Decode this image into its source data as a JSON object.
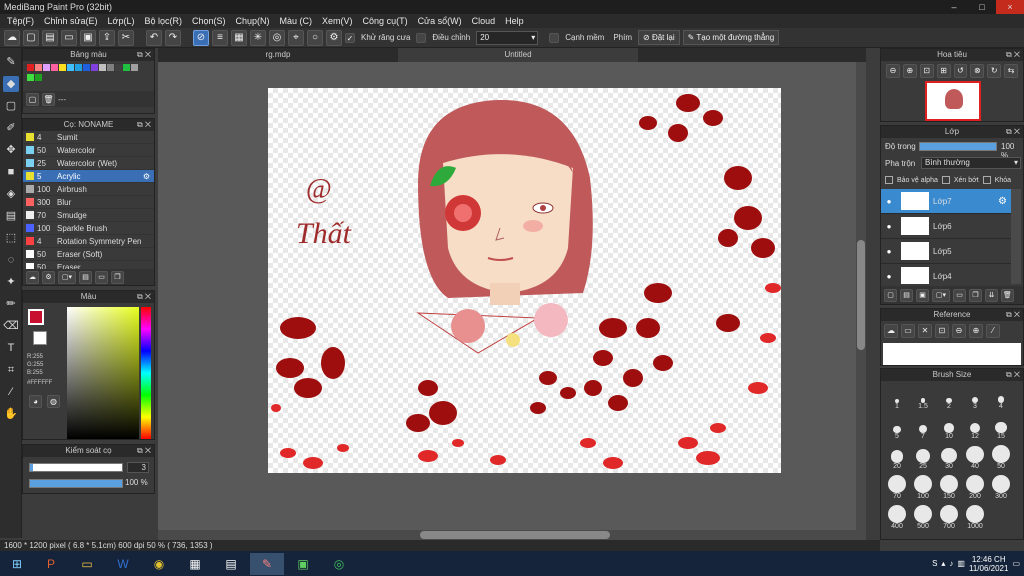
{
  "window": {
    "title": "MediBang Paint Pro (32bit)"
  },
  "menu": [
    "Tệp(F)",
    "Chỉnh sửa(E)",
    "Lớp(L)",
    "Bộ lọc(R)",
    "Chọn(S)",
    "Chụp(N)",
    "Màu (C)",
    "Xem(V)",
    "Công cụ(T)",
    "Cửa sổ(W)",
    "Cloud",
    "Help"
  ],
  "toolbar": {
    "antialias": "Khử răng cưa",
    "correction_label": "Điều chỉnh",
    "correction_value": "20",
    "soft_edge": "Cạnh mềm",
    "key_label": "Phím",
    "reset": "Đặt lại",
    "make_perspective": "Tạo một đường thẳng"
  },
  "palette": {
    "title": "Bảng màu",
    "empty": "---"
  },
  "brushes": {
    "title": "Cọ: NONAME",
    "items": [
      {
        "size": "4",
        "name": "Sumit",
        "color": "#e8e030"
      },
      {
        "size": "50",
        "name": "Watercolor",
        "color": "#7ad0f0"
      },
      {
        "size": "25",
        "name": "Watercolor (Wet)",
        "color": "#7ad0f0"
      },
      {
        "size": "5",
        "name": "Acrylic",
        "color": "#e8e030"
      },
      {
        "size": "100",
        "name": "Airbrush",
        "color": "#aaaaaa"
      },
      {
        "size": "300",
        "name": "Blur",
        "color": "#ff6060"
      },
      {
        "size": "70",
        "name": "Smudge",
        "color": "#eeeeee"
      },
      {
        "size": "100",
        "name": "Sparkle Brush",
        "color": "#4a60ff"
      },
      {
        "size": "4",
        "name": "Rotation Symmetry Pen",
        "color": "#ff4040"
      },
      {
        "size": "50",
        "name": "Eraser (Soft)",
        "color": "#ffffff"
      },
      {
        "size": "50",
        "name": "Eraser",
        "color": "#ffffff"
      }
    ]
  },
  "color": {
    "title": "Màu",
    "r": "R:255",
    "g": "G:255",
    "b": "B:255",
    "hex": "#FFFFFF"
  },
  "brush_control": {
    "title": "Kiểm soát cọ",
    "size": "3",
    "opacity": "100 %"
  },
  "tabs": [
    "rg.mdp",
    "Untitled"
  ],
  "canvas": {
    "signature_at": "@",
    "signature_name": "Thất"
  },
  "status": {
    "text": "1600 * 1200 pixel  ( 6.8 * 5.1cm)  600 dpi  50 %  ( 736, 1353 )"
  },
  "navigator": {
    "title": "Hoa tiêu"
  },
  "layers": {
    "title": "Lớp",
    "opacity_label": "Độ trong",
    "opacity_value": "100 %",
    "blend_label": "Pha trộn",
    "blend_value": "Bình thường",
    "protect_alpha": "Bảo vệ alpha",
    "clipping": "Xén bớt",
    "lock": "Khóa",
    "items": [
      "Lớp7",
      "Lớp6",
      "Lớp5",
      "Lớp4"
    ]
  },
  "reference": {
    "title": "Reference"
  },
  "brush_size": {
    "title": "Brush Size",
    "sizes": [
      "1",
      "1.5",
      "2",
      "3",
      "4",
      "5",
      "7",
      "10",
      "12",
      "15",
      "20",
      "25",
      "30",
      "40",
      "50",
      "70",
      "100",
      "150",
      "200",
      "300",
      "400",
      "500",
      "700",
      "1000"
    ]
  },
  "taskbar": {
    "time": "12:46 CH",
    "date": "11/06/2021"
  }
}
